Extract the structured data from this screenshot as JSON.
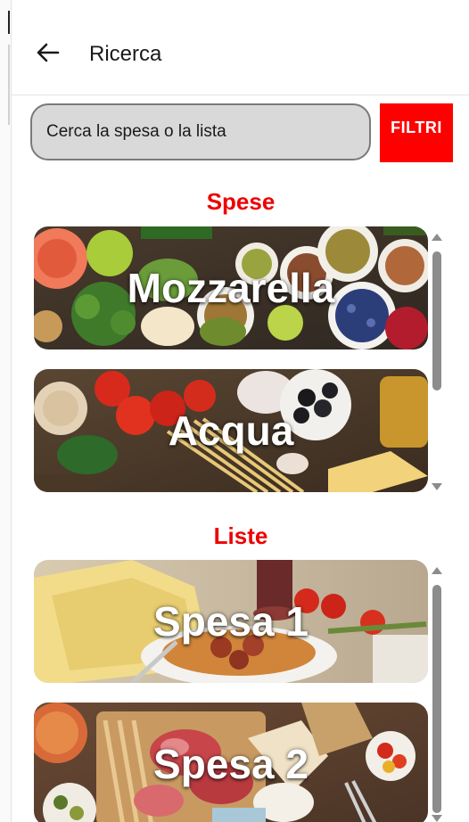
{
  "header": {
    "title": "Ricerca",
    "back_icon": "arrow-left-icon"
  },
  "search": {
    "value": "",
    "placeholder": "Cerca la spesa o la lista",
    "filter_label": "FILTRI"
  },
  "sections": {
    "spese": {
      "title": "Spese",
      "items": [
        {
          "label": "Mozzarella",
          "image": "vegetables-spices-bowls"
        },
        {
          "label": "Acqua",
          "image": "tomatoes-pasta-olives"
        }
      ]
    },
    "liste": {
      "title": "Liste",
      "items": [
        {
          "label": "Spesa 1",
          "image": "parmesan-spaghetti-wine"
        },
        {
          "label": "Spesa 2",
          "image": "cured-meats-board"
        }
      ]
    }
  },
  "colors": {
    "accent": "#ff0000",
    "section_title": "#ee0000",
    "search_bg": "#d9d9d9",
    "scroll_thumb": "#8c8c8c"
  }
}
